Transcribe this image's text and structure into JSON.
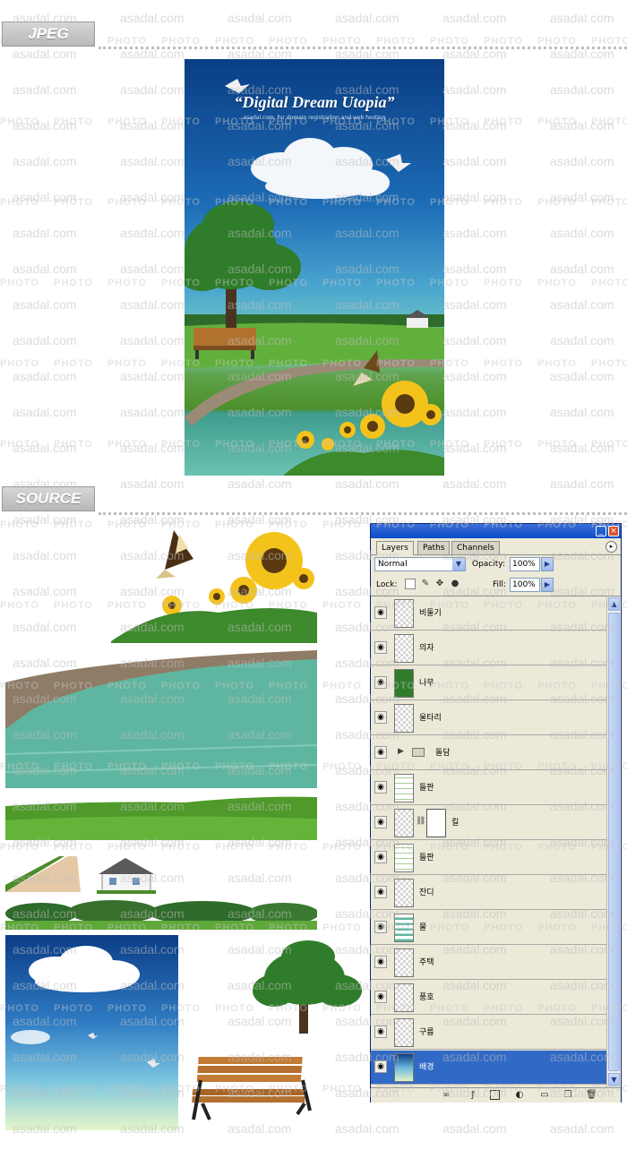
{
  "sections": {
    "jpeg_label": "JPEG",
    "source_label": "SOURCE"
  },
  "poster": {
    "title": "“Digital Dream Utopia”",
    "subtitle": "asadal.com, for domain registration and web hosting"
  },
  "watermark": {
    "text": "asadal.com",
    "photo": "PHOTO"
  },
  "photoshop": {
    "window_buttons": [
      "_",
      "×"
    ],
    "tabs": [
      {
        "label": "Layers",
        "active": true
      },
      {
        "label": "Paths",
        "active": false
      },
      {
        "label": "Channels",
        "active": false
      }
    ],
    "blend_mode": "Normal",
    "opacity_label": "Opacity:",
    "opacity_value": "100%",
    "lock_label": "Lock:",
    "fill_label": "Fill:",
    "fill_value": "100%",
    "layers": [
      {
        "name": "비둘기",
        "thumb": "transparent",
        "visible": true
      },
      {
        "name": "의자",
        "thumb": "transparent",
        "visible": true
      },
      {
        "name": "나무",
        "thumb": "tree",
        "visible": true
      },
      {
        "name": "울타리",
        "thumb": "transparent",
        "visible": true
      },
      {
        "name": "돌담",
        "thumb": "folder",
        "visible": true
      },
      {
        "name": "들판",
        "thumb": "field",
        "visible": true
      },
      {
        "name": "킬",
        "thumb": "mask",
        "visible": true
      },
      {
        "name": "들판",
        "thumb": "field",
        "visible": true
      },
      {
        "name": "잔디",
        "thumb": "transparent",
        "visible": true
      },
      {
        "name": "물",
        "thumb": "water",
        "visible": true
      },
      {
        "name": "주택",
        "thumb": "transparent",
        "visible": true
      },
      {
        "name": "풍호",
        "thumb": "transparent",
        "visible": true
      },
      {
        "name": "구름",
        "thumb": "transparent",
        "visible": true
      },
      {
        "name": "배경",
        "thumb": "sky",
        "visible": true,
        "selected": true
      }
    ],
    "colors": {
      "selected": "#3169c6",
      "titlebar": "#0a4dc8",
      "panel": "#ece9d8"
    }
  }
}
